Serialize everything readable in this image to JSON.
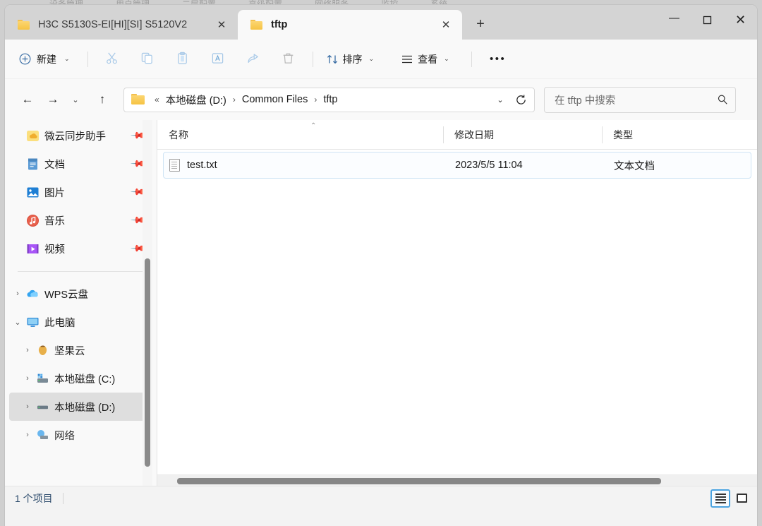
{
  "background_window": {
    "menu_items": [
      "设备管理",
      "用户管理",
      "二层配置",
      "高级配置",
      "网络服务",
      "监控",
      "系统"
    ]
  },
  "titlebar": {
    "tabs": [
      {
        "label": "H3C S5130S-EI[HI][SI] S5120V2",
        "icon": "folder-icon",
        "active": false,
        "close_label": "✕"
      },
      {
        "label": "tftp",
        "icon": "folder-icon",
        "active": true,
        "close_label": "✕"
      }
    ],
    "new_tab_label": "+",
    "window_controls": {
      "minimize": "—",
      "maximize": "maximize-icon",
      "close": "✕"
    }
  },
  "command_bar": {
    "new_label": "新建",
    "new_chevron": "⌄",
    "cut_label": "cut-icon",
    "copy_label": "copy-icon",
    "paste_label": "paste-icon",
    "rename_label": "rename-icon",
    "share_label": "share-icon",
    "delete_label": "delete-icon",
    "sort_label": "排序",
    "sort_chevron": "⌄",
    "view_label": "查看",
    "view_chevron": "⌄",
    "more_label": "•••"
  },
  "navbar": {
    "back": "←",
    "forward": "→",
    "recent_chevron": "⌄",
    "up": "↑",
    "breadcrumb": {
      "prefix": "«",
      "items": [
        "本地磁盘 (D:)",
        "Common Files",
        "tftp"
      ],
      "separator": "›"
    },
    "address_chevron": "⌄",
    "refresh": "refresh-icon",
    "search_placeholder": "在 tftp 中搜索",
    "search_icon": "search-icon"
  },
  "sidebar": {
    "quick_access": [
      {
        "label": "微云同步助手",
        "icon": "weiyun-icon",
        "pinned": true
      },
      {
        "label": "文档",
        "icon": "documents-icon",
        "pinned": true
      },
      {
        "label": "图片",
        "icon": "pictures-icon",
        "pinned": true
      },
      {
        "label": "音乐",
        "icon": "music-icon",
        "pinned": true
      },
      {
        "label": "视频",
        "icon": "videos-icon",
        "pinned": true
      }
    ],
    "tree": [
      {
        "label": "WPS云盘",
        "icon": "cloud-icon",
        "twisty": "›",
        "indent": 0,
        "selected": false
      },
      {
        "label": "此电脑",
        "icon": "this-pc-icon",
        "twisty": "⌄",
        "indent": 0,
        "selected": false
      },
      {
        "label": "坚果云",
        "icon": "nutstore-icon",
        "twisty": "›",
        "indent": 1,
        "selected": false
      },
      {
        "label": "本地磁盘 (C:)",
        "icon": "drive-c-icon",
        "twisty": "›",
        "indent": 1,
        "selected": false
      },
      {
        "label": "本地磁盘 (D:)",
        "icon": "drive-d-icon",
        "twisty": "›",
        "indent": 1,
        "selected": true
      },
      {
        "label": "网络",
        "icon": "network-icon",
        "twisty": "›",
        "indent": 0,
        "selected": false
      }
    ]
  },
  "file_list": {
    "columns": [
      {
        "label": "名称",
        "sorted": "asc",
        "sort_glyph": "⌃"
      },
      {
        "label": "修改日期",
        "sorted": null
      },
      {
        "label": "类型",
        "sorted": null
      }
    ],
    "rows": [
      {
        "name": "test.txt",
        "modified": "2023/5/5 11:04",
        "type": "文本文档",
        "icon": "text-file-icon",
        "selected": true
      }
    ]
  },
  "statusbar": {
    "item_count": "1 个项目",
    "view_details": "details-view-icon",
    "view_tiles": "tiles-view-icon"
  }
}
